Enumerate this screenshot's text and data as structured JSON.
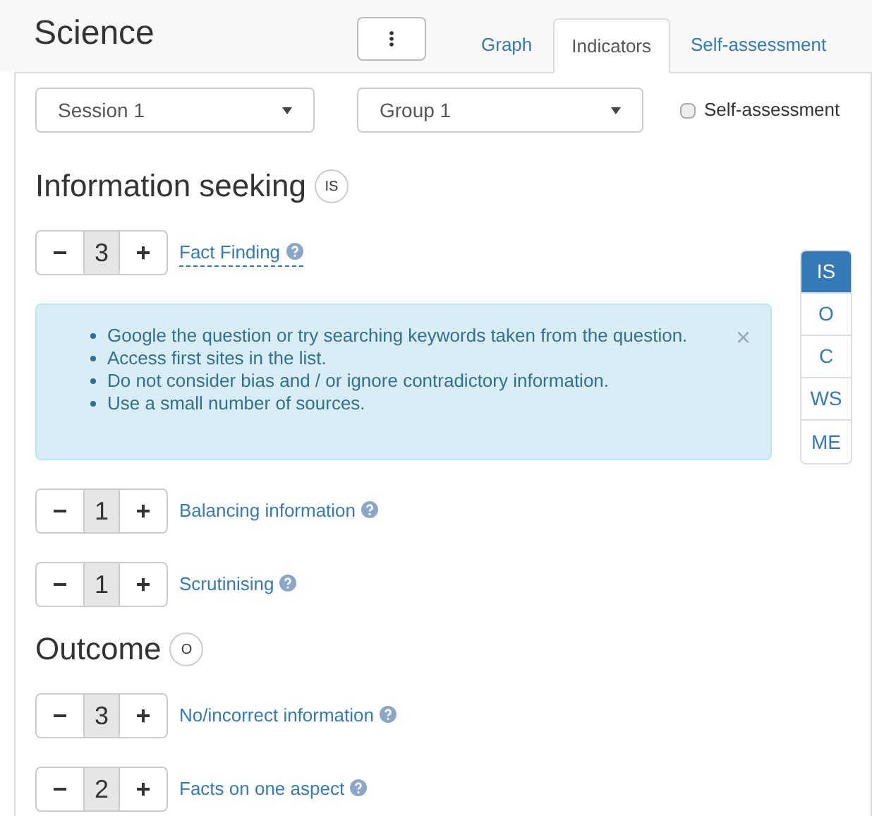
{
  "title": "Science",
  "tabs": [
    {
      "label": "Graph",
      "selected": false
    },
    {
      "label": "Indicators",
      "selected": true
    },
    {
      "label": "Self-assessment",
      "selected": false
    }
  ],
  "filters": {
    "session": "Session 1",
    "group": "Group 1",
    "self_assessment": {
      "label": "Self-assessment",
      "checked": false
    }
  },
  "sections": [
    {
      "heading": "Information seeking",
      "badge": "IS",
      "indicators": [
        {
          "minus": "−",
          "value": "3",
          "plus": "+",
          "label": "Fact Finding",
          "expanded": true,
          "tips": [
            "Google the question or try searching keywords taken from the question.",
            "Access first sites in the list.",
            "Do not consider bias and / or ignore contradictory information.",
            "Use a small number of sources."
          ],
          "close": "×"
        },
        {
          "minus": "−",
          "value": "1",
          "plus": "+",
          "label": "Balancing information",
          "expanded": false
        },
        {
          "minus": "−",
          "value": "1",
          "plus": "+",
          "label": "Scrutinising",
          "expanded": false
        }
      ]
    },
    {
      "heading": "Outcome",
      "badge": "O",
      "indicators": [
        {
          "minus": "−",
          "value": "3",
          "plus": "+",
          "label": "No/incorrect information",
          "expanded": false
        },
        {
          "minus": "−",
          "value": "2",
          "plus": "+",
          "label": "Facts on one aspect",
          "expanded": false
        }
      ]
    }
  ],
  "side_nav": [
    {
      "label": "IS",
      "selected": true
    },
    {
      "label": "O",
      "selected": false
    },
    {
      "label": "C",
      "selected": false
    },
    {
      "label": "WS",
      "selected": false
    },
    {
      "label": "ME",
      "selected": false
    }
  ]
}
